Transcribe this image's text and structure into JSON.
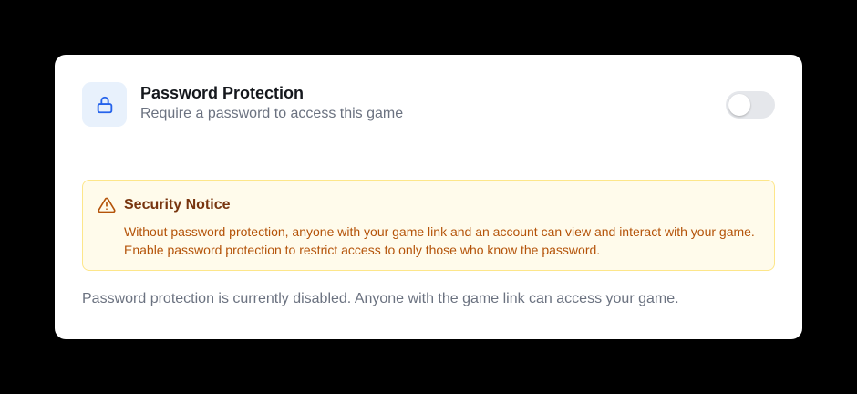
{
  "setting": {
    "title": "Password Protection",
    "subtitle": "Require a password to access this game",
    "icon": "lock-icon",
    "toggle_on": false
  },
  "notice": {
    "icon": "warning-triangle-icon",
    "title": "Security Notice",
    "body": "Without password protection, anyone with your game link and an account can view and interact with your game. Enable password protection to restrict access to only those who know the password."
  },
  "status_text": "Password protection is currently disabled. Anyone with the game link can access your game.",
  "colors": {
    "accent": "#2563eb",
    "notice_background": "#fffbeb",
    "notice_border": "#fde68a",
    "warning": "#b45309"
  }
}
